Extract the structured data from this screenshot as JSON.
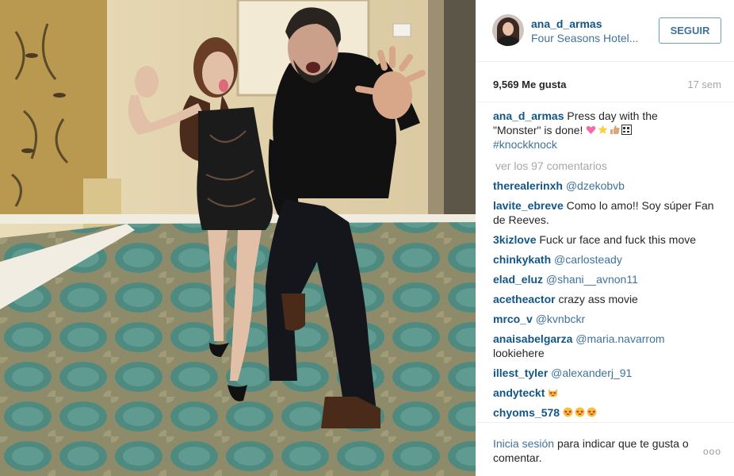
{
  "post": {
    "username": "ana_d_armas",
    "location": "Four Seasons Hotel...",
    "follow_label": "SEGUIR",
    "likes": "9,569 Me gusta",
    "time_ago": "17 sem",
    "caption_user": "ana_d_armas",
    "caption_text": "Press day with the \"Monster\" is done!",
    "caption_hashtag": "#knockknock",
    "view_comments": "ver los 97 comentarios"
  },
  "comments": [
    {
      "user": "therealerinxh",
      "mention": "@dzekobvb",
      "text": ""
    },
    {
      "user": "lavite_ebreve",
      "mention": "",
      "text": "Como lo amo!! Soy súper Fan de Reeves."
    },
    {
      "user": "3kizlove",
      "mention": "",
      "text": "Fuck ur face and fuck this move"
    },
    {
      "user": "chinkykath",
      "mention": "@carlosteady",
      "text": ""
    },
    {
      "user": "elad_eluz",
      "mention": "@shani__avnon11",
      "text": ""
    },
    {
      "user": "acetheactor",
      "mention": "",
      "text": "crazy ass movie"
    },
    {
      "user": "mrco_v",
      "mention": "@kvnbckr",
      "text": ""
    },
    {
      "user": "anaisabelgarza",
      "mention": "@maria.navarrom",
      "text": "lookiehere"
    },
    {
      "user": "illest_tyler",
      "mention": "@alexanderj_91",
      "text": ""
    },
    {
      "user": "andyteckt",
      "mention": "",
      "text": ""
    },
    {
      "user": "chyoms_578",
      "mention": "",
      "text": ""
    }
  ],
  "footer": {
    "login_link": "Inicia sesión",
    "login_rest": "para indicar que te gusta o comentar.",
    "more_options": "ooo"
  },
  "colors": {
    "username_blue": "#125688",
    "link_blue": "#3f729b",
    "muted": "#a5a7aa",
    "text": "#262626"
  },
  "icons": {
    "caption_emojis": [
      "sparkling-heart-emoji",
      "star-emoji",
      "thumbs-up-emoji",
      "free-sign-emoji"
    ],
    "andyteckt_emojis": [
      "heart-eyes-cat-emoji"
    ],
    "chyoms_emojis": [
      "heart-eyes-emoji",
      "heart-eyes-emoji",
      "heart-eyes-emoji"
    ]
  }
}
